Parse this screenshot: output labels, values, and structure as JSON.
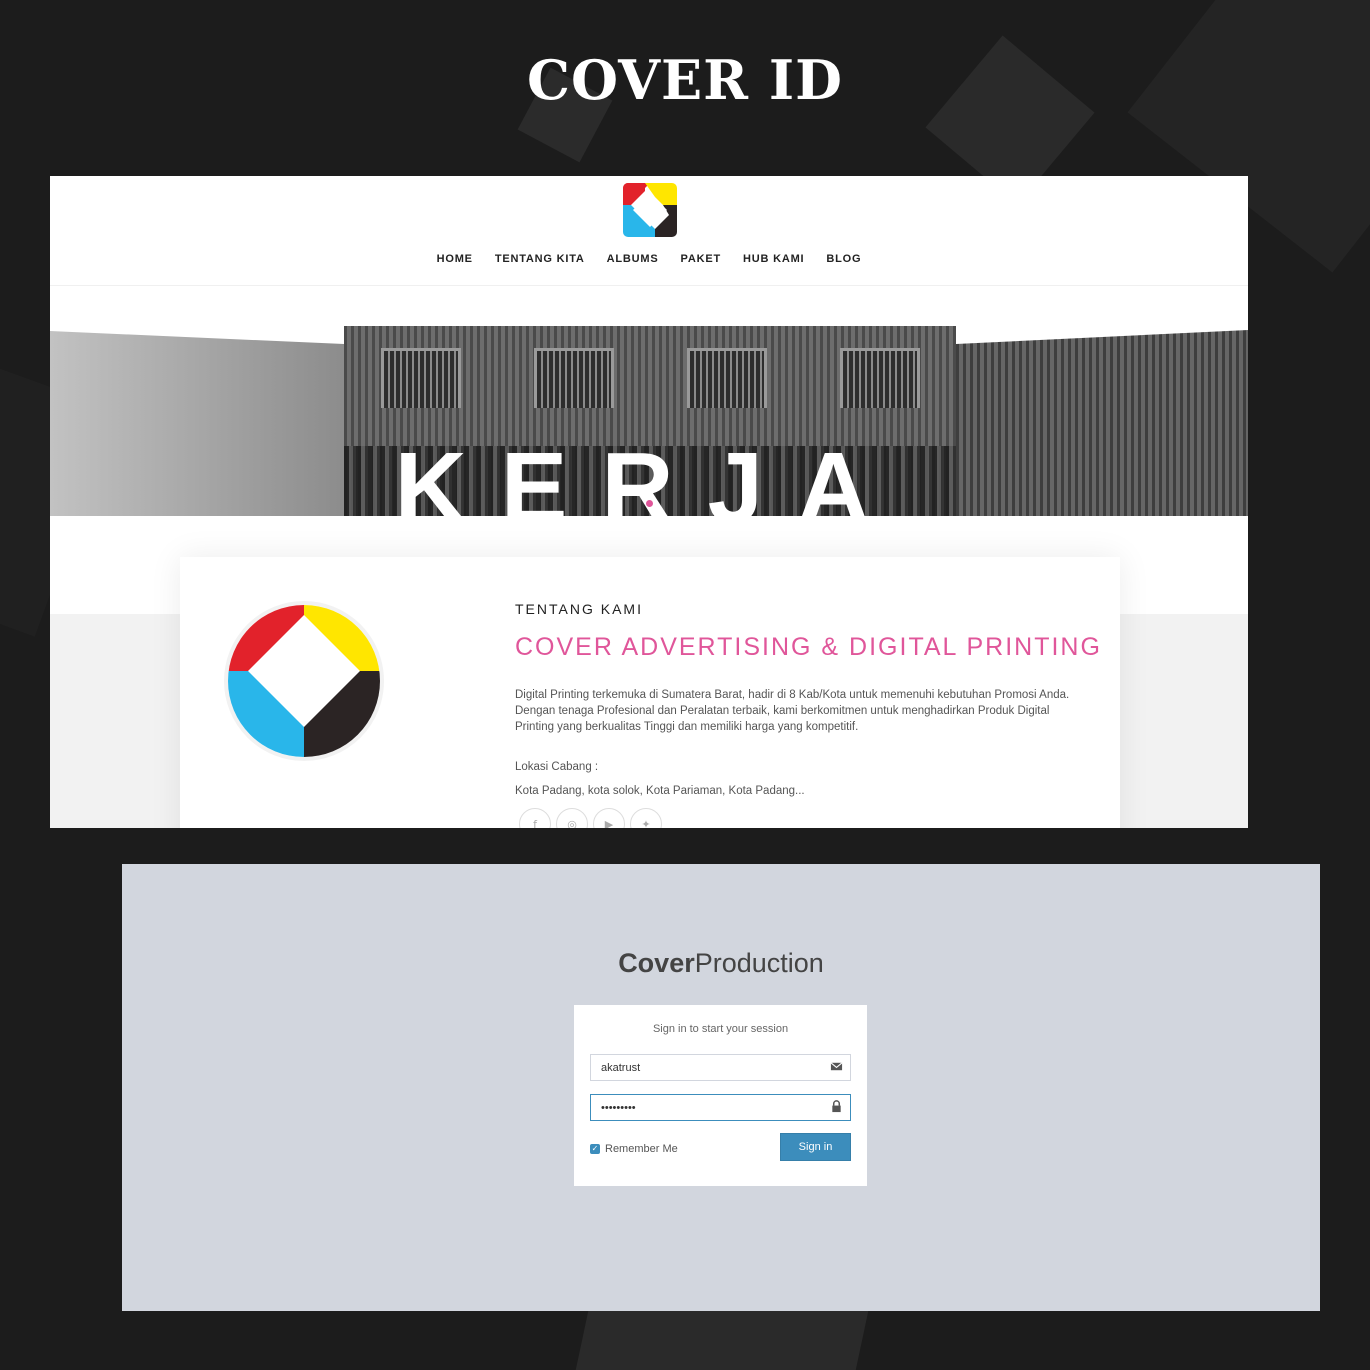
{
  "showcase": {
    "title": "COVER ID"
  },
  "website": {
    "nav": [
      "HOME",
      "TENTANG KITA",
      "ALBUMS",
      "PAKET",
      "HUB KAMI",
      "BLOG"
    ],
    "hero_text": "KERJA",
    "about": {
      "kicker": "TENTANG KAMI",
      "title": "COVER ADVERTISING & DIGITAL PRINTING",
      "description": "Digital Printing terkemuka di Sumatera Barat, hadir di 8 Kab/Kota untuk memenuhi kebutuhan Promosi Anda. Dengan tenaga Profesional dan Peralatan terbaik, kami berkomitmen untuk menghadirkan Produk Digital Printing yang berkualitas Tinggi dan memiliki harga yang kompetitif.",
      "branch_label": "Lokasi Cabang :",
      "branches": "Kota Padang, kota solok, Kota Pariaman, Kota Padang...",
      "socials": [
        "facebook-icon",
        "instagram-icon",
        "youtube-icon",
        "twitter-icon"
      ]
    },
    "colors": {
      "accent": "#e0569a",
      "logo_red": "#e2222b",
      "logo_yellow": "#ffe600",
      "logo_cyan": "#29b6ea",
      "logo_black": "#2b2424"
    }
  },
  "login": {
    "logo_bold": "Cover",
    "logo_light": "Production",
    "message": "Sign in to start your session",
    "email_value": "akatrust",
    "password_value": "•••••••••",
    "remember_label": "Remember Me",
    "remember_checked": true,
    "signin_label": "Sign in",
    "colors": {
      "background": "#d2d6de",
      "button": "#3c8dbc"
    }
  }
}
